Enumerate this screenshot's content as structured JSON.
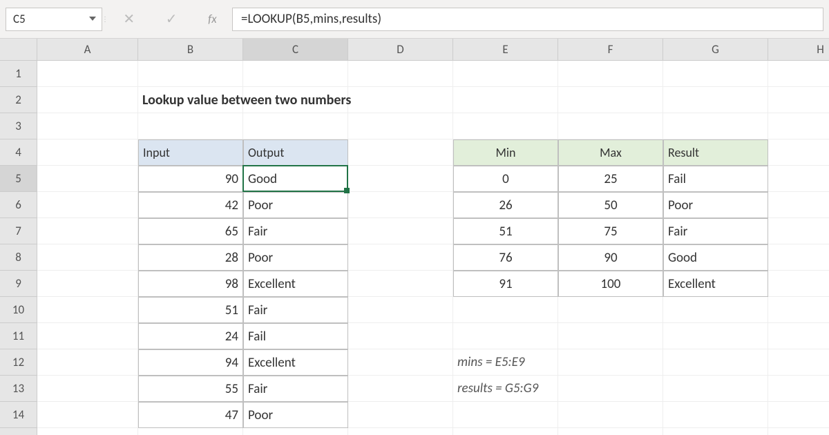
{
  "name_box": "C5",
  "formula": "=LOOKUP(B5,mins,results)",
  "columns": [
    "A",
    "B",
    "C",
    "D",
    "E",
    "F",
    "G",
    "H"
  ],
  "rows": [
    "1",
    "2",
    "3",
    "4",
    "5",
    "6",
    "7",
    "8",
    "9",
    "10",
    "11",
    "12",
    "13",
    "14"
  ],
  "active_col": "C",
  "active_row": "5",
  "title": "Lookup value between two numbers",
  "io_headers": {
    "input": "Input",
    "output": "Output"
  },
  "io_rows": [
    {
      "in": "90",
      "out": "Good"
    },
    {
      "in": "42",
      "out": "Poor"
    },
    {
      "in": "65",
      "out": "Fair"
    },
    {
      "in": "28",
      "out": "Poor"
    },
    {
      "in": "98",
      "out": "Excellent"
    },
    {
      "in": "51",
      "out": "Fair"
    },
    {
      "in": "24",
      "out": "Fail"
    },
    {
      "in": "94",
      "out": "Excellent"
    },
    {
      "in": "55",
      "out": "Fair"
    },
    {
      "in": "47",
      "out": "Poor"
    }
  ],
  "lkp_headers": {
    "min": "Min",
    "max": "Max",
    "result": "Result"
  },
  "lkp_rows": [
    {
      "min": "0",
      "max": "25",
      "res": "Fail"
    },
    {
      "min": "26",
      "max": "50",
      "res": "Poor"
    },
    {
      "min": "51",
      "max": "75",
      "res": "Fair"
    },
    {
      "min": "76",
      "max": "90",
      "res": "Good"
    },
    {
      "min": "91",
      "max": "100",
      "res": "Excellent"
    }
  ],
  "notes": {
    "mins": "mins = E5:E9",
    "results": "results = G5:G9"
  }
}
